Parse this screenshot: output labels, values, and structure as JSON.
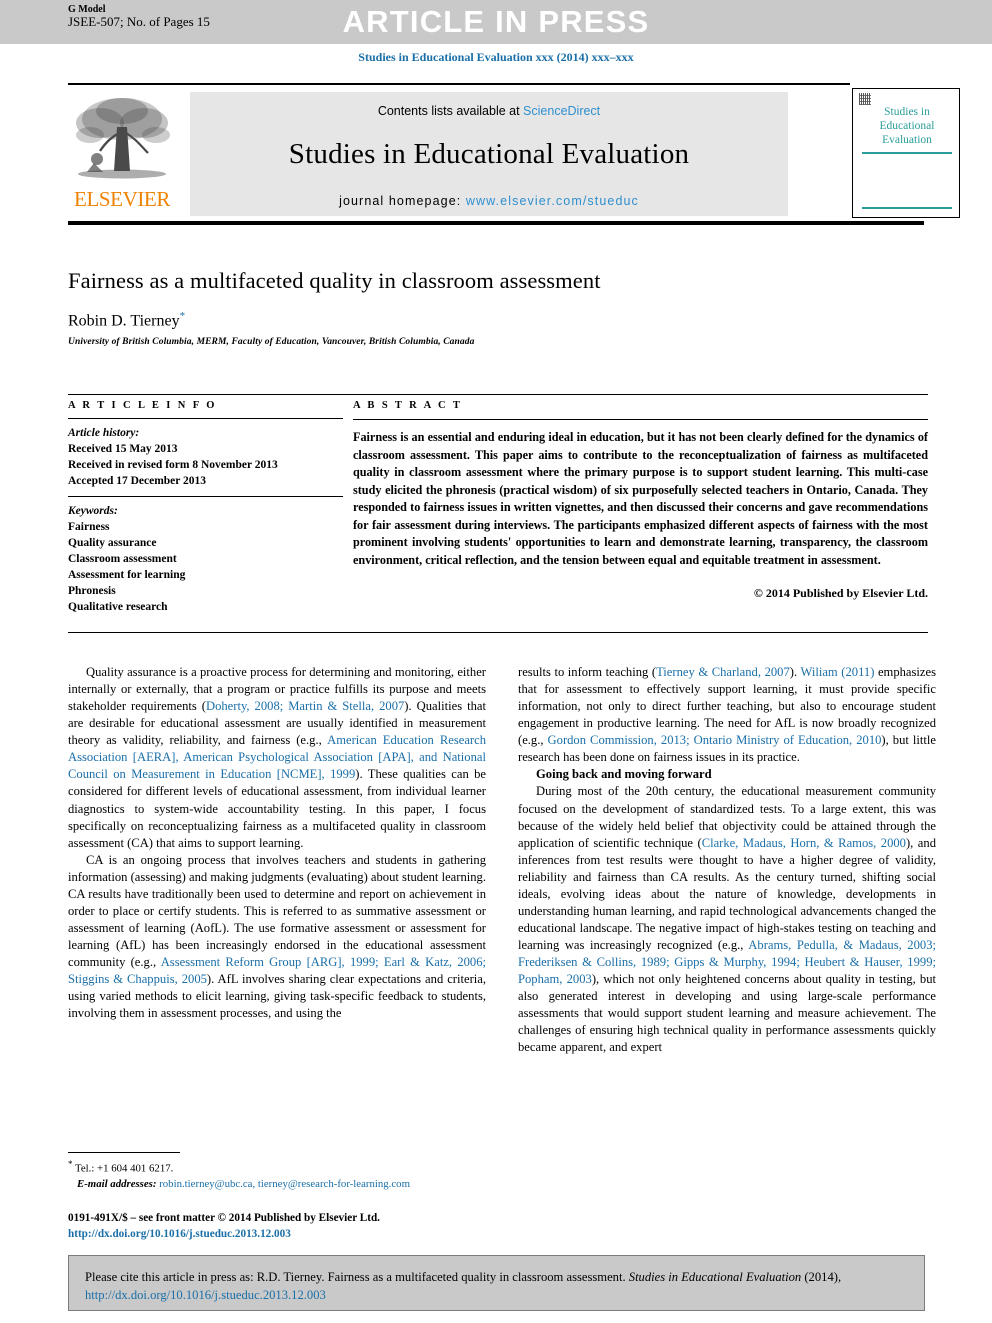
{
  "banner": {
    "press_text": "ARTICLE IN PRESS",
    "gmodel_line1": "G Model",
    "gmodel_line2": "JSEE-507; No. of Pages 15"
  },
  "journal_ref": "Studies in Educational Evaluation xxx (2014) xxx–xxx",
  "masthead": {
    "contents_prefix": "Contents lists available at ",
    "sciencedirect": "ScienceDirect",
    "journal_title": "Studies in Educational Evaluation",
    "homepage_label": "journal homepage:",
    "homepage_url": "www.elsevier.com/stueduc",
    "publisher": "ELSEVIER",
    "cover_title": "Studies in\nEducational\nEvaluation"
  },
  "article": {
    "title": "Fairness as a multifaceted quality in classroom assessment",
    "author": "Robin D. Tierney",
    "author_marker": "*",
    "affiliation": "University of British Columbia, MERM, Faculty of Education, Vancouver, British Columbia, Canada"
  },
  "info": {
    "heading": "A R T I C L E   I N F O",
    "history_label": "Article history:",
    "history": [
      "Received 15 May 2013",
      "Received in revised form 8 November 2013",
      "Accepted 17 December 2013"
    ],
    "keywords_label": "Keywords:",
    "keywords": [
      "Fairness",
      "Quality assurance",
      "Classroom assessment",
      "Assessment for learning",
      "Phronesis",
      "Qualitative research"
    ]
  },
  "abstract": {
    "heading": "A B S T R A C T",
    "text": "Fairness is an essential and enduring ideal in education, but it has not been clearly defined for the dynamics of classroom assessment. This paper aims to contribute to the reconceptualization of fairness as multifaceted quality in classroom assessment where the primary purpose is to support student learning. This multi-case study elicited the phronesis (practical wisdom) of six purposefully selected teachers in Ontario, Canada. They responded to fairness issues in written vignettes, and then discussed their concerns and gave recommendations for fair assessment during interviews. The participants emphasized different aspects of fairness with the most prominent involving students' opportunities to learn and demonstrate learning, transparency, the classroom environment, critical reflection, and the tension between equal and equitable treatment in assessment.",
    "copyright": "© 2014 Published by Elsevier Ltd."
  },
  "body": {
    "left": {
      "p1_a": "Quality assurance is a proactive process for determining and monitoring, either internally or externally, that a program or practice fulfills its purpose and meets stakeholder requirements (",
      "p1_ref1": "Doherty, 2008; Martin & Stella, 2007",
      "p1_b": "). Qualities that are desirable for educational assessment are usually identified in measurement theory as validity, reliability, and fairness (e.g., ",
      "p1_ref2": "American Education Research Association [AERA], American Psychological Association [APA], and National Council on Measurement in Education [NCME], 1999",
      "p1_c": "). These qualities can be considered for different levels of educational assessment, from individual learner diagnostics to system-wide accountability testing. In this paper, I focus specifically on reconceptualizing fairness as a multifaceted quality in classroom assessment (CA) that aims to support learning.",
      "p2_a": "CA is an ongoing process that involves teachers and students in gathering information (assessing) and making judgments (evaluating) about student learning. CA results have traditionally been used to determine and report on achievement in order to place or certify students. This is referred to as summative assessment or assessment of learning (AofL). The use formative assessment or assessment for learning (AfL) has been increasingly endorsed in the educational assessment community (e.g., ",
      "p2_ref1": "Assessment Reform Group [ARG], 1999; Earl & Katz, 2006; Stiggins & Chappuis, 2005",
      "p2_b": "). AfL involves sharing clear expectations and criteria, using varied methods to elicit learning, giving task-specific feedback to students, involving them in assessment processes, and using the"
    },
    "right": {
      "p1_a": "results to inform teaching (",
      "p1_ref1": "Tierney & Charland, 2007",
      "p1_b": "). ",
      "p1_ref2": "Wiliam (2011)",
      "p1_c": " emphasizes that for assessment to effectively support learning, it must provide specific information, not only to direct further teaching, but also to encourage student engagement in productive learning. The need for AfL is now broadly recognized (e.g., ",
      "p1_ref3": "Gordon Commission, 2013; Ontario Ministry of Education, 2010",
      "p1_d": "), but little research has been done on fairness issues in its practice.",
      "section_heading": "Going back and moving forward",
      "p2_a": "During most of the 20th century, the educational measurement community focused on the development of standardized tests. To a large extent, this was because of the widely held belief that objectivity could be attained through the application of scientific technique (",
      "p2_ref1": "Clarke, Madaus, Horn, & Ramos, 2000",
      "p2_b": "), and inferences from test results were thought to have a higher degree of validity, reliability and fairness than CA results. As the century turned, shifting social ideals, evolving ideas about the nature of knowledge, developments in understanding human learning, and rapid technological advancements changed the educational landscape. The negative impact of high-stakes testing on teaching and learning was increasingly recognized (e.g., ",
      "p2_ref2": "Abrams, Pedulla, & Madaus, 2003; Frederiksen & Collins, 1989; Gipps & Murphy, 1994; Heubert & Hauser, 1999; Popham, 2003",
      "p2_c": "), which not only heightened concerns about quality in testing, but also generated interest in developing and using large-scale performance assessments that would support student learning and measure achievement. The challenges of ensuring high technical quality in performance assessments quickly became apparent, and expert"
    }
  },
  "footnote": {
    "marker": "*",
    "tel": "Tel.: +1 604 401 6217.",
    "email_label": "E-mail addresses:",
    "emails": "robin.tierney@ubc.ca, tierney@research-for-learning.com"
  },
  "frontmatter": {
    "line1": "0191-491X/$ – see front matter © 2014 Published by Elsevier Ltd.",
    "doi": "http://dx.doi.org/10.1016/j.stueduc.2013.12.003"
  },
  "cite_box": {
    "prefix": "Please cite this article in press as: R.D. Tierney. Fairness as a multifaceted quality in classroom assessment. ",
    "journal_italic": "Studies in Educational Evaluation",
    "year": " (2014), ",
    "doi": "http://dx.doi.org/10.1016/j.stueduc.2013.12.003"
  },
  "colors": {
    "link": "#1a6fa8",
    "sciencedirect": "#2f8fd0",
    "elsevier_orange": "#ef8200",
    "cover_teal": "#2a9d9a",
    "banner_gray": "#c9c9c9"
  }
}
